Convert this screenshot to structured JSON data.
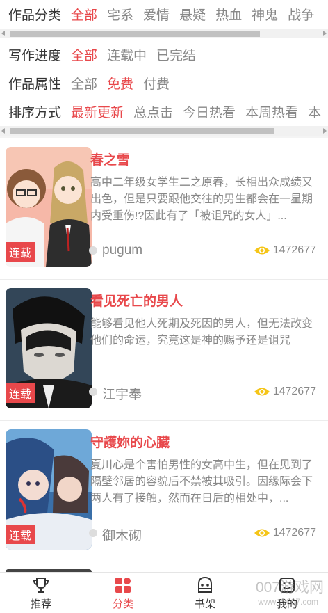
{
  "filters": {
    "category": {
      "label": "作品分类",
      "options": [
        "全部",
        "宅系",
        "爱情",
        "悬疑",
        "热血",
        "神鬼",
        "战争"
      ],
      "active": 0
    },
    "progress": {
      "label": "写作进度",
      "options": [
        "全部",
        "连载中",
        "已完结"
      ],
      "active": 0
    },
    "attribute": {
      "label": "作品属性",
      "options": [
        "全部",
        "免费",
        "付费"
      ],
      "active": 1
    },
    "sort": {
      "label": "排序方式",
      "options": [
        "最新更新",
        "总点击",
        "今日热看",
        "本周热看",
        "本"
      ],
      "active": 0
    }
  },
  "comics": [
    {
      "title": "春之雪",
      "desc": "高中二年级女学生二之原春，长相出众成绩又出色，但是只要跟他交往的男生都会在一星期内受重伤!?因此有了「被诅咒的女人」...",
      "author": "pugum",
      "views": "1472677",
      "badge": "连载"
    },
    {
      "title": "看见死亡的男人",
      "desc": "能够看见他人死期及死因的男人，但无法改变他们的命运，究竟这是神的赐予还是诅咒",
      "author": "江宇奉",
      "views": "1472677",
      "badge": "连载"
    },
    {
      "title": "守護妳的心臟",
      "desc": "夏川心是个害怕男性的女高中生，但在见到了隔壁邻居的容貌后不禁被其吸引。因缘际会下两人有了接触，然而在日后的相处中，...",
      "author": "御木砌",
      "views": "1472677",
      "badge": "连载"
    }
  ],
  "tabbar": [
    {
      "label": "推荐",
      "icon": "trophy-icon"
    },
    {
      "label": "分类",
      "icon": "category-icon"
    },
    {
      "label": "书架",
      "icon": "bookshelf-icon"
    },
    {
      "label": "我的",
      "icon": "profile-icon"
    }
  ],
  "active_tab": 1,
  "watermark": {
    "main": "007游戏网",
    "sub": "www.yx007.com"
  },
  "colors": {
    "accent": "#e8484b",
    "muted": "#888888",
    "eye": "#f5c518"
  }
}
